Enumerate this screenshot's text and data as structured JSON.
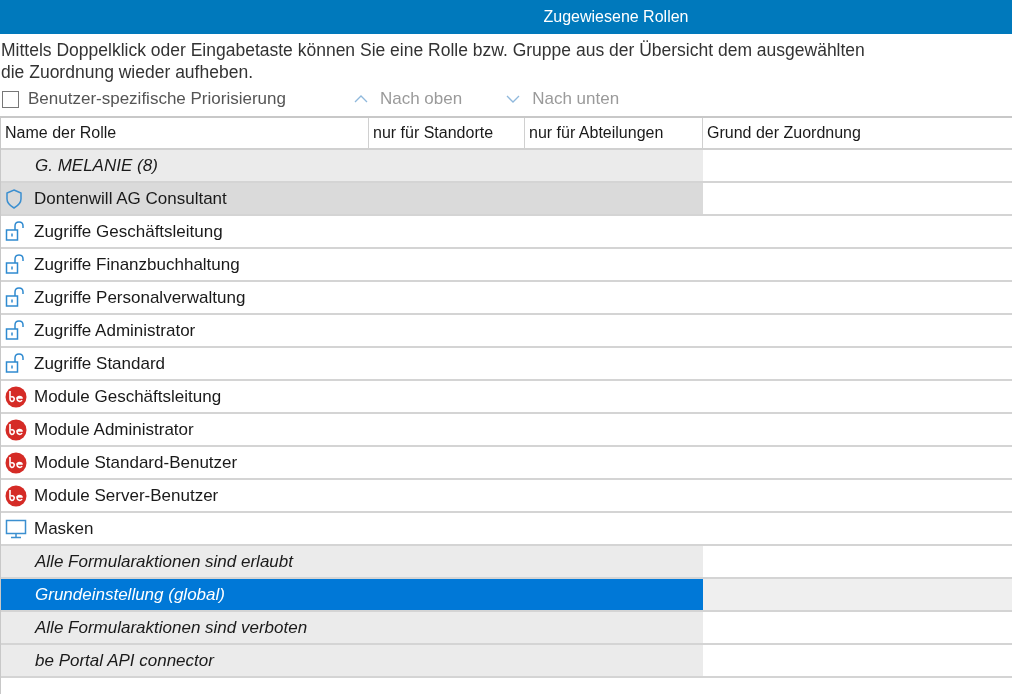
{
  "panel": {
    "title": "Zugewiesene Rollen"
  },
  "description": [
    "Mittels Doppelklick oder Eingabetaste können Sie eine Rolle bzw. Gruppe aus der Übersicht dem ausgewählten",
    "die Zuordnung wieder aufheben."
  ],
  "toolbar": {
    "checkbox": {
      "label": "Benutzer-spezifische Priorisierung",
      "checked": false
    },
    "buttons": [
      {
        "label": "Nach oben",
        "kind": "up",
        "disabled": true
      },
      {
        "label": "Nach unten",
        "kind": "down",
        "disabled": true
      }
    ]
  },
  "table": {
    "columns": [
      "Name der Rolle",
      "nur für Standorte",
      "nur für Abteilungen",
      "Grund der Zuordnung"
    ],
    "rows": [
      {
        "kind": "group",
        "name": "G. MELANIE (8)",
        "selected": false,
        "hovered": false
      },
      {
        "kind": "shield",
        "name": "Dontenwill AG Consultant",
        "selected": false,
        "hovered": true
      },
      {
        "kind": "lock",
        "name": "Zugriffe Geschäftsleitung",
        "selected": false,
        "hovered": false
      },
      {
        "kind": "lock",
        "name": "Zugriffe Finanzbuchhaltung",
        "selected": false,
        "hovered": false
      },
      {
        "kind": "lock",
        "name": "Zugriffe Personalverwaltung",
        "selected": false,
        "hovered": false
      },
      {
        "kind": "lock",
        "name": "Zugriffe Administrator",
        "selected": false,
        "hovered": false
      },
      {
        "kind": "lock",
        "name": "Zugriffe Standard",
        "selected": false,
        "hovered": false
      },
      {
        "kind": "module",
        "name": "Module Geschäftsleitung",
        "selected": false,
        "hovered": false
      },
      {
        "kind": "module",
        "name": "Module Administrator",
        "selected": false,
        "hovered": false
      },
      {
        "kind": "module",
        "name": "Module Standard-Benutzer",
        "selected": false,
        "hovered": false
      },
      {
        "kind": "module",
        "name": "Module Server-Benutzer",
        "selected": false,
        "hovered": false
      },
      {
        "kind": "monitor",
        "name": "Masken",
        "selected": false,
        "hovered": false
      },
      {
        "kind": "group",
        "name": "Alle Formularaktionen sind erlaubt",
        "selected": false,
        "hovered": false
      },
      {
        "kind": "group",
        "name": "Grundeinstellung (global)",
        "selected": true,
        "hovered": false
      },
      {
        "kind": "group",
        "name": "Alle Formularaktionen sind verboten",
        "selected": false,
        "hovered": false
      },
      {
        "kind": "group",
        "name": "be Portal API connector",
        "selected": false,
        "hovered": false
      }
    ]
  }
}
